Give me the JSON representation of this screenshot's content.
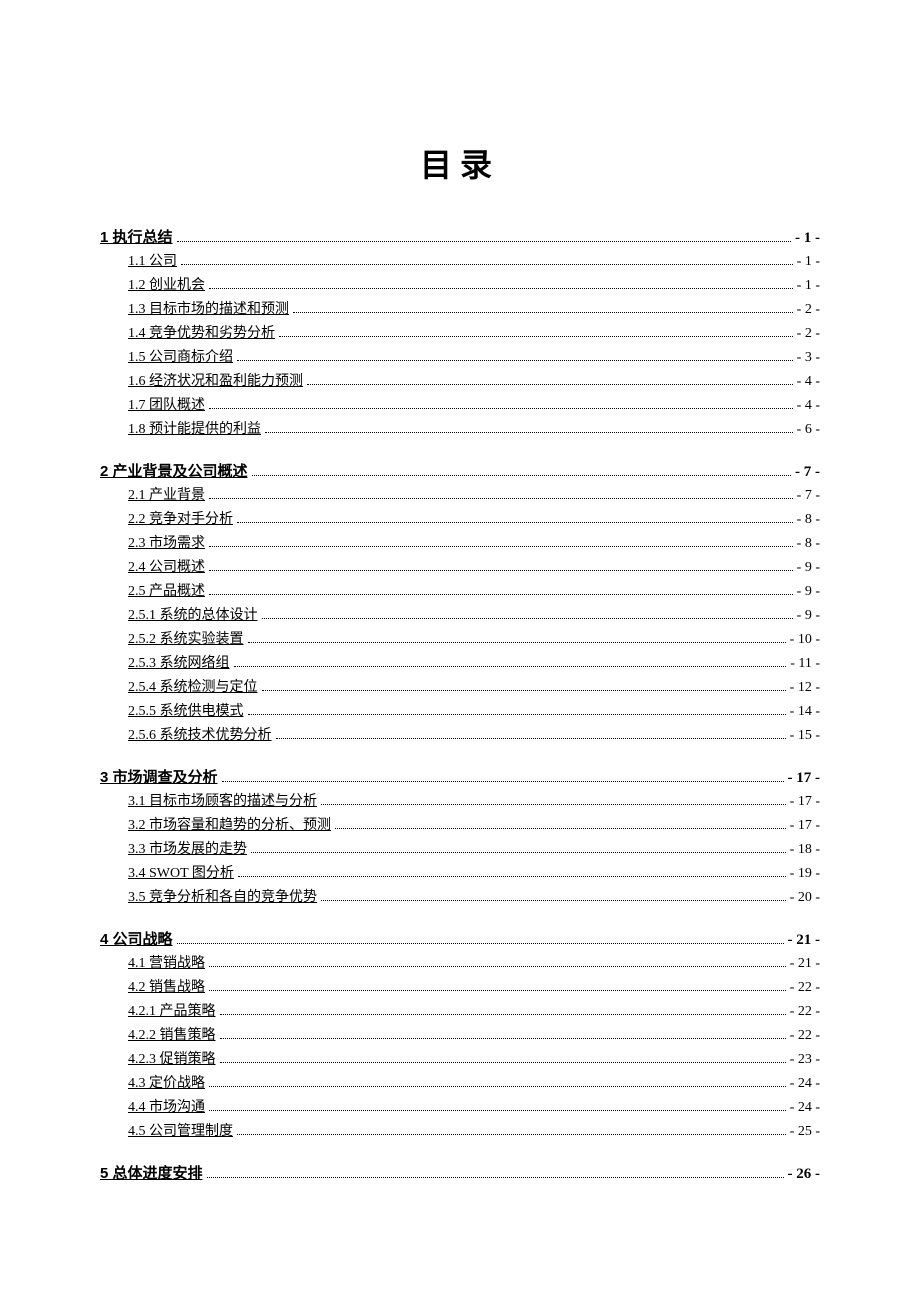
{
  "title": "目录",
  "sections": [
    {
      "heading": {
        "label": "1 执行总结",
        "page": "- 1 -"
      },
      "items": [
        {
          "label": "1.1 公司",
          "page": "- 1 -"
        },
        {
          "label": "1.2 创业机会",
          "page": "- 1 -"
        },
        {
          "label": "1.3 目标市场的描述和预测",
          "page": "- 2 -"
        },
        {
          "label": "1.4 竞争优势和劣势分析",
          "page": "- 2 -"
        },
        {
          "label": "1.5 公司商标介绍",
          "page": "- 3 -"
        },
        {
          "label": "1.6 经济状况和盈利能力预测",
          "page": "- 4 -"
        },
        {
          "label": "1.7 团队概述",
          "page": "- 4 -"
        },
        {
          "label": "1.8 预计能提供的利益",
          "page": "- 6 -"
        }
      ]
    },
    {
      "heading": {
        "label": "2 产业背景及公司概述",
        "page": "- 7 -"
      },
      "items": [
        {
          "label": "2.1 产业背景",
          "page": "- 7 -"
        },
        {
          "label": "2.2 竞争对手分析",
          "page": "- 8 -"
        },
        {
          "label": "2.3 市场需求",
          "page": "- 8 -"
        },
        {
          "label": "2.4 公司概述",
          "page": "- 9 -"
        },
        {
          "label": "2.5 产品概述",
          "page": "- 9 -"
        },
        {
          "label": "2.5.1 系统的总体设计",
          "page": "- 9 -"
        },
        {
          "label": "2.5.2 系统实验装置",
          "page": "- 10 -"
        },
        {
          "label": "2.5.3 系统网络组",
          "page": "- 11 -"
        },
        {
          "label": "2.5.4 系统检测与定位",
          "page": "- 12 -"
        },
        {
          "label": "2.5.5 系统供电模式",
          "page": "- 14 -"
        },
        {
          "label": "2.5.6 系统技术优势分析",
          "page": "- 15 -"
        }
      ]
    },
    {
      "heading": {
        "label": "3 市场调查及分析",
        "page": "- 17 -"
      },
      "items": [
        {
          "label": "3.1 目标市场顾客的描述与分析",
          "page": "- 17 -"
        },
        {
          "label": "3.2 市场容量和趋势的分析、预测",
          "page": "- 17 -"
        },
        {
          "label": "3.3 市场发展的走势",
          "page": "- 18 -"
        },
        {
          "label": "3.4 SWOT 图分析",
          "page": "- 19 -"
        },
        {
          "label": "3.5 竞争分析和各自的竞争优势",
          "page": "- 20 -"
        }
      ]
    },
    {
      "heading": {
        "label": "4 公司战略",
        "page": "- 21 -"
      },
      "items": [
        {
          "label": "4.1 营销战略",
          "page": "- 21 -"
        },
        {
          "label": "4.2 销售战略",
          "page": "- 22 -"
        },
        {
          "label": "4.2.1 产品策略",
          "page": "- 22 -"
        },
        {
          "label": "4.2.2 销售策略",
          "page": "- 22 -"
        },
        {
          "label": "4.2.3 促销策略",
          "page": "- 23 -"
        },
        {
          "label": "4.3 定价战略",
          "page": "- 24 -"
        },
        {
          "label": "4.4 市场沟通",
          "page": "- 24 -"
        },
        {
          "label": "4.5 公司管理制度",
          "page": "- 25 -"
        }
      ]
    },
    {
      "heading": {
        "label": "5 总体进度安排",
        "page": "- 26 -"
      },
      "items": []
    }
  ]
}
